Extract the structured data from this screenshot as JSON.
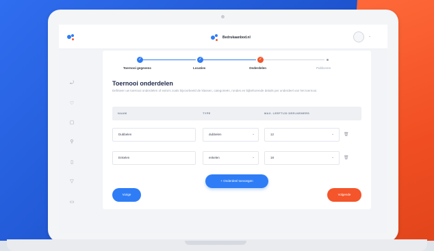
{
  "header": {
    "brand_name": "Bedrukaanbod.nl"
  },
  "stepper": {
    "steps": [
      {
        "label": "Toernooi gegevens",
        "status": "done"
      },
      {
        "label": "Locaties",
        "status": "done"
      },
      {
        "label": "Onderdelen",
        "status": "active"
      },
      {
        "label": "Publiceren",
        "status": "pending"
      }
    ]
  },
  "section": {
    "title": "Toernooi onderdelen",
    "description": "Definieer uw toernooi onderdelen of extra's zoals bijvoorbeeld de klassen, categorieën, rondes en bijbehorende details per onderdeel van het toernooi."
  },
  "table": {
    "columns": [
      "NAAM",
      "TYPE",
      "MAX. LEEFTIJD DEELNEMERS"
    ],
    "rows": [
      {
        "name": "Dubbelen",
        "type": "dubbelen",
        "max_age": "12"
      },
      {
        "name": "Enkelen",
        "type": "enkelen",
        "max_age": "18"
      }
    ]
  },
  "actions": {
    "add_label": "+ Onderdeel toevoegen",
    "back_label": "Vorige",
    "next_label": "Volgende"
  },
  "colors": {
    "primary_blue": "#2f7df6",
    "accent_orange": "#f4552a",
    "background_blue": "#1d52cc"
  }
}
